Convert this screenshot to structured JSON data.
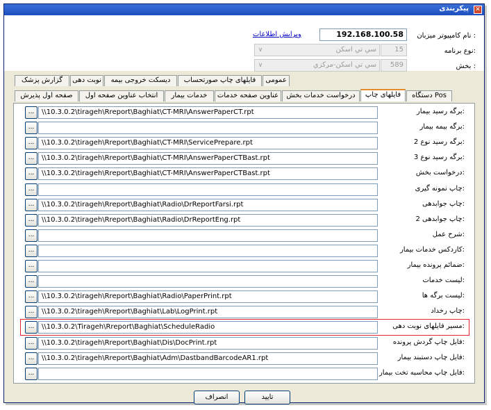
{
  "window": {
    "title": "پیکربندی"
  },
  "header": {
    "host_label": "نام کامپیوتر میزبان :",
    "host_value": "192.168.100.58",
    "edit_link": "ویرایش اطلاعات",
    "program_type_label": "نوع برنامه:",
    "program_type_code": "15",
    "program_type_name": "سي تي اسكن",
    "section_label": "بخش :",
    "section_code": "589",
    "section_name": "سي تي اسكن-مركزي"
  },
  "tabs_row1": [
    "عمومی",
    "فایلهای چاپ صورتحساب",
    "دیسکت خروجی بیمه",
    "نوبت دهی",
    "گزارش پزشک"
  ],
  "tabs_row2": [
    "دستگاه Pos",
    "فایلهای چاپ",
    "درخواست خدمات بخش",
    "عناوین صفحه خدمات",
    "خدمات بیمار",
    "انتخاب عناوین صفحه اول",
    "صفحه اول پذیرش"
  ],
  "active_tab": "فایلهای چاپ",
  "browse_label": "...",
  "rows": [
    {
      "label": "برگه رسید بیمار:",
      "path": "\\\\10.3.0.2\\tirageh\\Rreport\\Baghiat\\CT-MRI\\AnswerPaperCT.rpt"
    },
    {
      "label": "برگه بیمه بیمار:",
      "path": ""
    },
    {
      "label": "برگه رسید نوع 2:",
      "path": "\\\\10.3.0.2\\tirageh\\Rreport\\Baghiat\\CT-MRI\\ServicePrepare.rpt"
    },
    {
      "label": "برگه رسید نوع 3:",
      "path": "\\\\10.3.0.2\\tirageh\\Rreport\\Baghiat\\CT-MRI\\AnswerPaperCTBast.rpt"
    },
    {
      "label": "درخواست بخش:",
      "path": "\\\\10.3.0.2\\tirageh\\Rreport\\Baghiat\\CT-MRI\\AnswerPaperCTBast.rpt"
    },
    {
      "label": "چاپ نمونه گیری:",
      "path": ""
    },
    {
      "label": "چاپ جوابدهی:",
      "path": "\\\\10.3.0.2\\tirageh\\Rreport\\Baghiat\\Radio\\DrReportFarsi.rpt"
    },
    {
      "label": "چاپ جوابدهی 2:",
      "path": "\\\\10.3.0.2\\tirageh\\Rreport\\Baghiat\\Radio\\DrReportEng.rpt"
    },
    {
      "label": "شرح عمل:",
      "path": ""
    },
    {
      "label": "کاردکس خدمات بیمار:",
      "path": ""
    },
    {
      "label": "ضمائم پرونده بیمار:",
      "path": ""
    },
    {
      "label": "لیست خدمات:",
      "path": ""
    },
    {
      "label": "لیست برگه ها:",
      "path": "\\\\10.3.0.2\\tirageh\\Rreport\\Baghiat\\Radio\\PaperPrint.rpt"
    },
    {
      "label": "چاپ رخداد:",
      "path": "\\\\10.3.0.2\\tirageh\\Rreport\\Baghiat\\Lab\\LogPrint.rpt"
    },
    {
      "label": "مسیر فایلهای نوبت دهی:",
      "path": "\\\\10.3.0.2\\Tirageh\\Rreport\\Baghiat\\ScheduleRadio"
    },
    {
      "label": "فایل چاپ گردش پرونده:",
      "path": "\\\\10.3.0.2\\tirageh\\Rreport\\Baghiat\\Dis\\DocPrint.rpt"
    },
    {
      "label": "فایل چاپ دستبند بیمار:",
      "path": "\\\\10.3.0.2\\tirageh\\Rreport\\Baghiat\\Adm\\DastbandBarcodeAR1.rpt"
    },
    {
      "label": "فایل چاپ محاسبه تخت بیمار:",
      "path": ""
    }
  ],
  "highlight_row_index": 14,
  "buttons": {
    "ok": "تایید",
    "cancel": "انصراف"
  },
  "colors": {
    "title_bar": "#1c4fbe",
    "active_tab_accent": "#e68b2c",
    "highlight": "#e0242e",
    "link": "#0000c8"
  }
}
